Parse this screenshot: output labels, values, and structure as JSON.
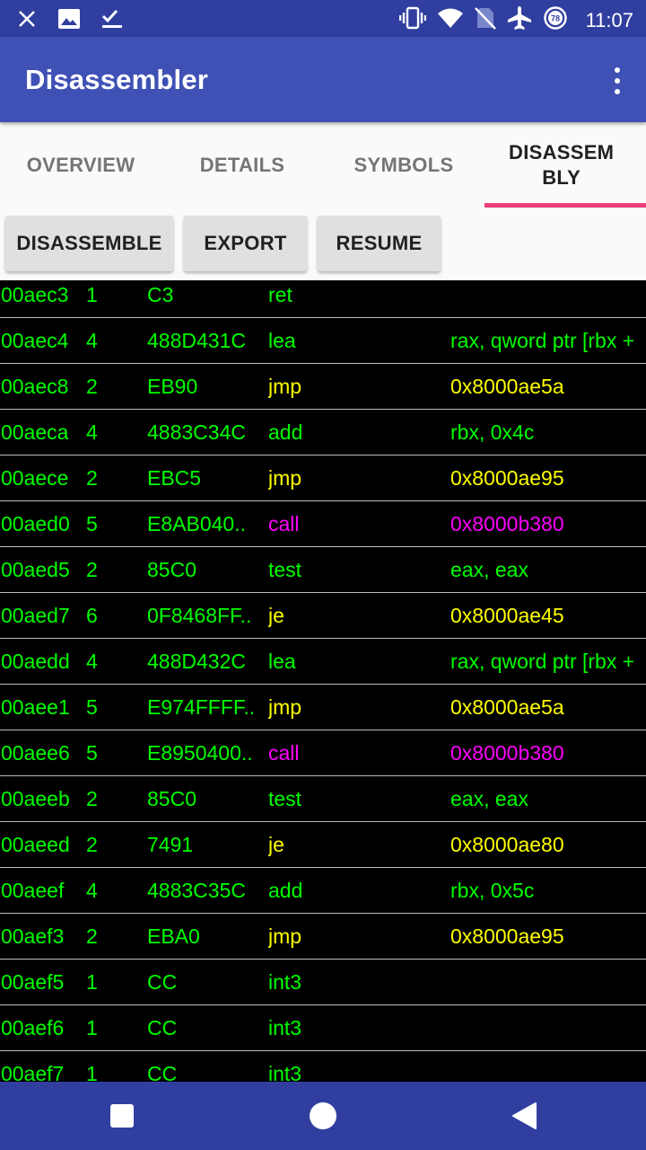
{
  "status_bar": {
    "time": "11:07",
    "battery_level": "78",
    "left_icons": [
      "close-icon",
      "image-icon",
      "checklist-icon"
    ],
    "right_icons": [
      "vibrate-icon",
      "wifi-icon",
      "no-sim-icon",
      "airplane-icon",
      "battery-saver-icon"
    ]
  },
  "app_bar": {
    "title": "Disassembler"
  },
  "tabs": [
    {
      "label": "OVERVIEW",
      "active": false
    },
    {
      "label": "DETAILS",
      "active": false
    },
    {
      "label": "SYMBOLS",
      "active": false
    },
    {
      "label": "DISASSEM\nBLY",
      "active": true
    }
  ],
  "toolbar": {
    "disassemble_label": "DISASSEMBLE",
    "export_label": "EXPORT",
    "resume_label": "RESUME"
  },
  "colors": {
    "app_bar": "#3F51B5",
    "status_bar": "#303F9F",
    "tab_indicator": "#EC407A",
    "green": "#00FF00",
    "yellow": "#FFFF00",
    "magenta": "#FF00FF",
    "background": "#000000"
  },
  "disassembly": {
    "rows": [
      {
        "address": "00aec3",
        "size": "1",
        "bytes": "C3",
        "mnemonic": "ret",
        "operands": "",
        "kind": "normal"
      },
      {
        "address": "00aec4",
        "size": "4",
        "bytes": "488D431C",
        "mnemonic": "lea",
        "operands": "rax, qword ptr [rbx +",
        "kind": "normal"
      },
      {
        "address": "00aec8",
        "size": "2",
        "bytes": "EB90",
        "mnemonic": "jmp",
        "operands": "0x8000ae5a",
        "kind": "jump"
      },
      {
        "address": "00aeca",
        "size": "4",
        "bytes": "4883C34C",
        "mnemonic": "add",
        "operands": "rbx, 0x4c",
        "kind": "normal"
      },
      {
        "address": "00aece",
        "size": "2",
        "bytes": "EBC5",
        "mnemonic": "jmp",
        "operands": "0x8000ae95",
        "kind": "jump"
      },
      {
        "address": "00aed0",
        "size": "5",
        "bytes": "E8AB040..",
        "mnemonic": "call",
        "operands": "0x8000b380",
        "kind": "call"
      },
      {
        "address": "00aed5",
        "size": "2",
        "bytes": "85C0",
        "mnemonic": "test",
        "operands": "eax, eax",
        "kind": "normal"
      },
      {
        "address": "00aed7",
        "size": "6",
        "bytes": "0F8468FF..",
        "mnemonic": "je",
        "operands": "0x8000ae45",
        "kind": "jump"
      },
      {
        "address": "00aedd",
        "size": "4",
        "bytes": "488D432C",
        "mnemonic": "lea",
        "operands": "rax, qword ptr [rbx +",
        "kind": "normal"
      },
      {
        "address": "00aee1",
        "size": "5",
        "bytes": "E974FFFF..",
        "mnemonic": "jmp",
        "operands": "0x8000ae5a",
        "kind": "jump"
      },
      {
        "address": "00aee6",
        "size": "5",
        "bytes": "E8950400..",
        "mnemonic": "call",
        "operands": "0x8000b380",
        "kind": "call"
      },
      {
        "address": "00aeeb",
        "size": "2",
        "bytes": "85C0",
        "mnemonic": "test",
        "operands": "eax, eax",
        "kind": "normal"
      },
      {
        "address": "00aeed",
        "size": "2",
        "bytes": "7491",
        "mnemonic": "je",
        "operands": "0x8000ae80",
        "kind": "jump"
      },
      {
        "address": "00aeef",
        "size": "4",
        "bytes": "4883C35C",
        "mnemonic": "add",
        "operands": "rbx, 0x5c",
        "kind": "normal"
      },
      {
        "address": "00aef3",
        "size": "2",
        "bytes": "EBA0",
        "mnemonic": "jmp",
        "operands": "0x8000ae95",
        "kind": "jump"
      },
      {
        "address": "00aef5",
        "size": "1",
        "bytes": "CC",
        "mnemonic": "int3",
        "operands": "",
        "kind": "normal"
      },
      {
        "address": "00aef6",
        "size": "1",
        "bytes": "CC",
        "mnemonic": "int3",
        "operands": "",
        "kind": "normal"
      },
      {
        "address": "00aef7",
        "size": "1",
        "bytes": "CC",
        "mnemonic": "int3",
        "operands": "",
        "kind": "normal"
      }
    ]
  },
  "nav_bar": {
    "buttons": [
      "recents-icon",
      "home-icon",
      "back-icon"
    ]
  }
}
